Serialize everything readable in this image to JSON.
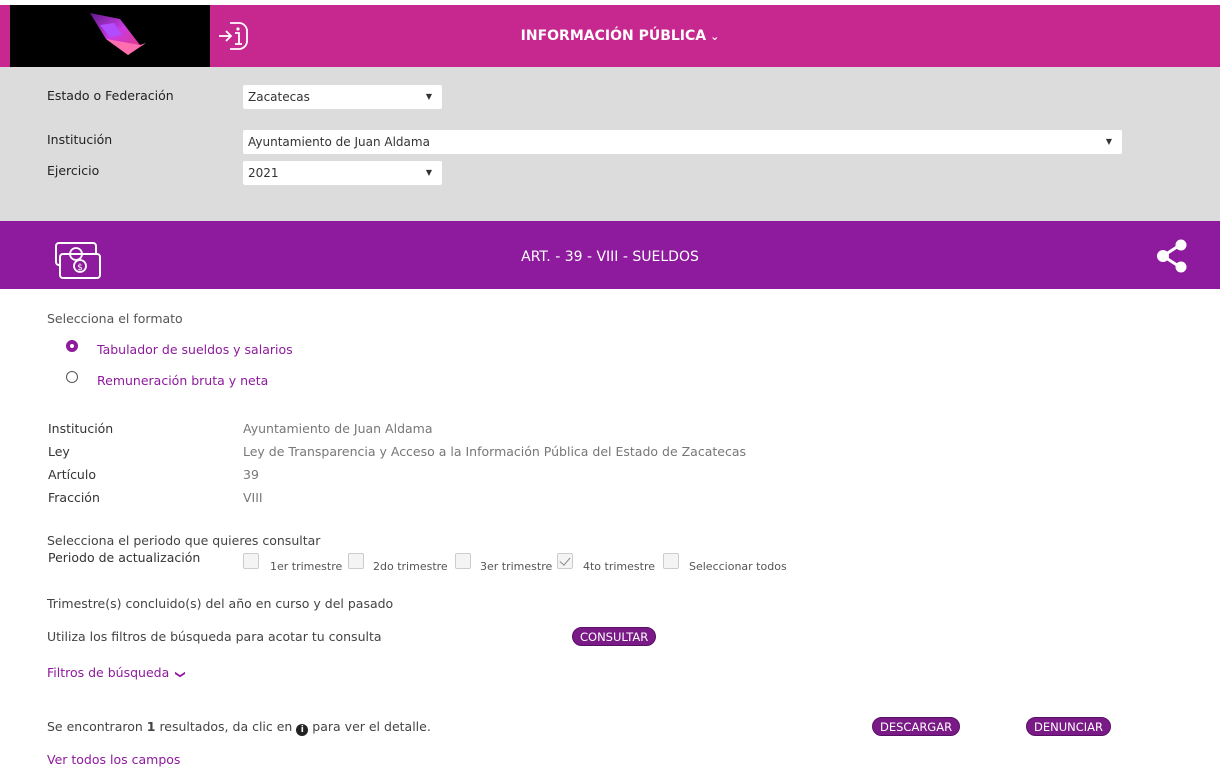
{
  "header": {
    "title": "INFORMACIÓN PÚBLICA",
    "chevron": "⌄",
    "logo_icon": "brand-logo",
    "login_icon": "login-info-icon",
    "color": "#c6288f"
  },
  "filters": {
    "estado_label": "Estado o Federación",
    "estado_value": "Zacatecas",
    "institucion_label": "Institución",
    "institucion_value": "Ayuntamiento de Juan Aldama",
    "ejercicio_label": "Ejercicio",
    "ejercicio_value": "2021",
    "arrow": "▼"
  },
  "section": {
    "title": "ART. - 39 - VIII - SUELDOS",
    "icon": "money-icon",
    "share_icon": "share-icon",
    "color": "#8e1a9d"
  },
  "format": {
    "prompt": "Selecciona el formato",
    "options": [
      {
        "label": "Tabulador de sueldos y salarios",
        "selected": true
      },
      {
        "label": "Remuneración bruta y neta",
        "selected": false
      }
    ]
  },
  "details": [
    {
      "label": "Institución",
      "value": "Ayuntamiento de Juan Aldama"
    },
    {
      "label": "Ley",
      "value": "Ley de Transparencia y Acceso a la Información Pública del Estado de Zacatecas"
    },
    {
      "label": "Artículo",
      "value": "39"
    },
    {
      "label": "Fracción",
      "value": "VIII"
    }
  ],
  "period": {
    "prompt": "Selecciona el periodo que quieres consultar",
    "label": "Periodo de actualización",
    "options": [
      {
        "label": "1er trimestre",
        "checked": false
      },
      {
        "label": "2do trimestre",
        "checked": false
      },
      {
        "label": "3er trimestre",
        "checked": false
      },
      {
        "label": "4to trimestre",
        "checked": true
      },
      {
        "label": "Seleccionar todos",
        "checked": false
      }
    ],
    "note": "Trimestre(s) concluido(s) del año en curso y del pasado"
  },
  "search": {
    "hint": "Utiliza los filtros de búsqueda para acotar tu consulta",
    "consult_button": "CONSULTAR",
    "filters_link": "Filtros de búsqueda",
    "filters_chevron": "❯"
  },
  "results": {
    "prefix": "Se encontraron ",
    "count": "1",
    "middle": " resultados, da clic en ",
    "suffix": " para ver el detalle.",
    "info_icon": "info-icon",
    "download_button": "DESCARGAR",
    "report_button": "DENUNCIAR",
    "all_fields_link": "Ver todos los campos"
  }
}
